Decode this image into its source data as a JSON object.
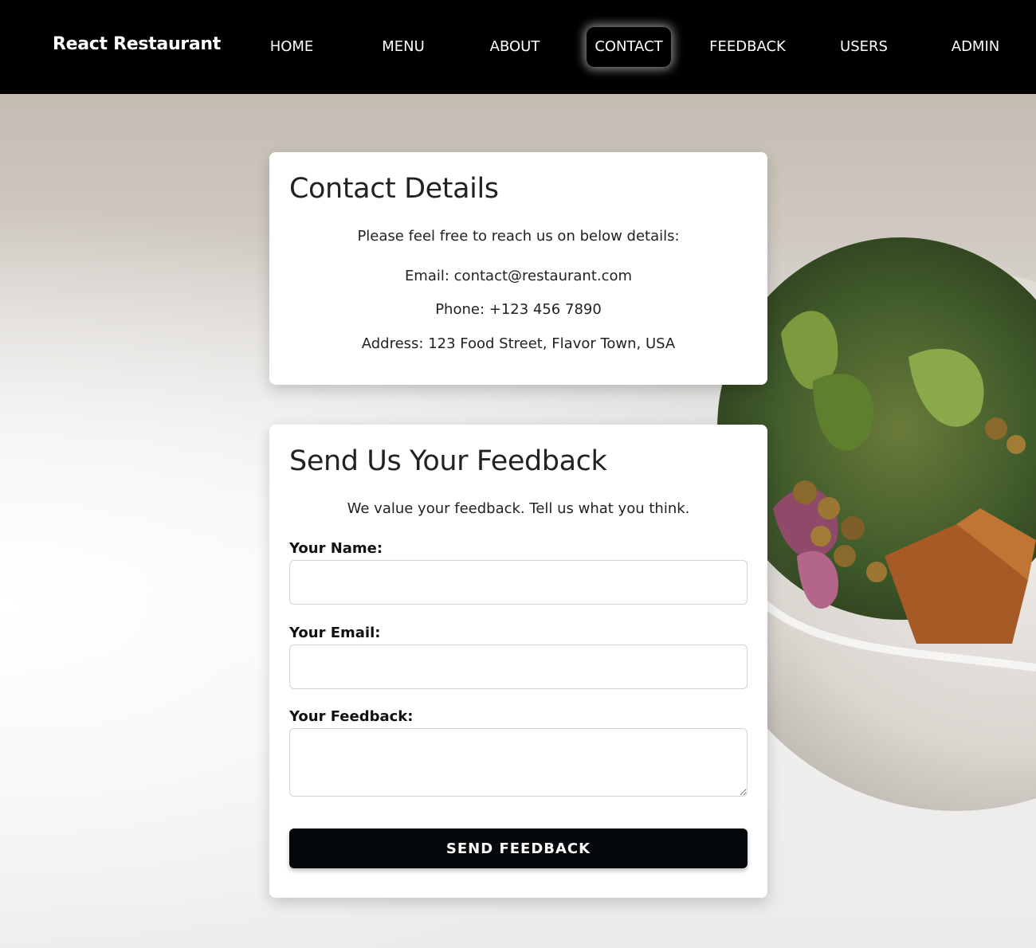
{
  "navbar": {
    "brand": "React Restaurant",
    "links": [
      {
        "label": "HOME"
      },
      {
        "label": "MENU"
      },
      {
        "label": "ABOUT"
      },
      {
        "label": "CONTACT",
        "active": true
      },
      {
        "label": "FEEDBACK"
      },
      {
        "label": "USERS"
      },
      {
        "label": "ADMIN"
      }
    ]
  },
  "contact": {
    "title": "Contact Details",
    "intro": "Please feel free to reach us on below details:",
    "email": "Email: contact@restaurant.com",
    "phone": "Phone: +123 456 7890",
    "address": "Address: 123 Food Street, Flavor Town, USA"
  },
  "feedback": {
    "title": "Send Us Your Feedback",
    "intro": "We value your feedback. Tell us what you think.",
    "name_label": "Your Name:",
    "name_value": "",
    "email_label": "Your Email:",
    "email_value": "",
    "feedback_label": "Your Feedback:",
    "feedback_value": "",
    "submit_label": "SEND FEEDBACK"
  },
  "colors": {
    "navbar_bg": "#000000",
    "button_bg": "#05080b",
    "card_bg": "#ffffff"
  }
}
